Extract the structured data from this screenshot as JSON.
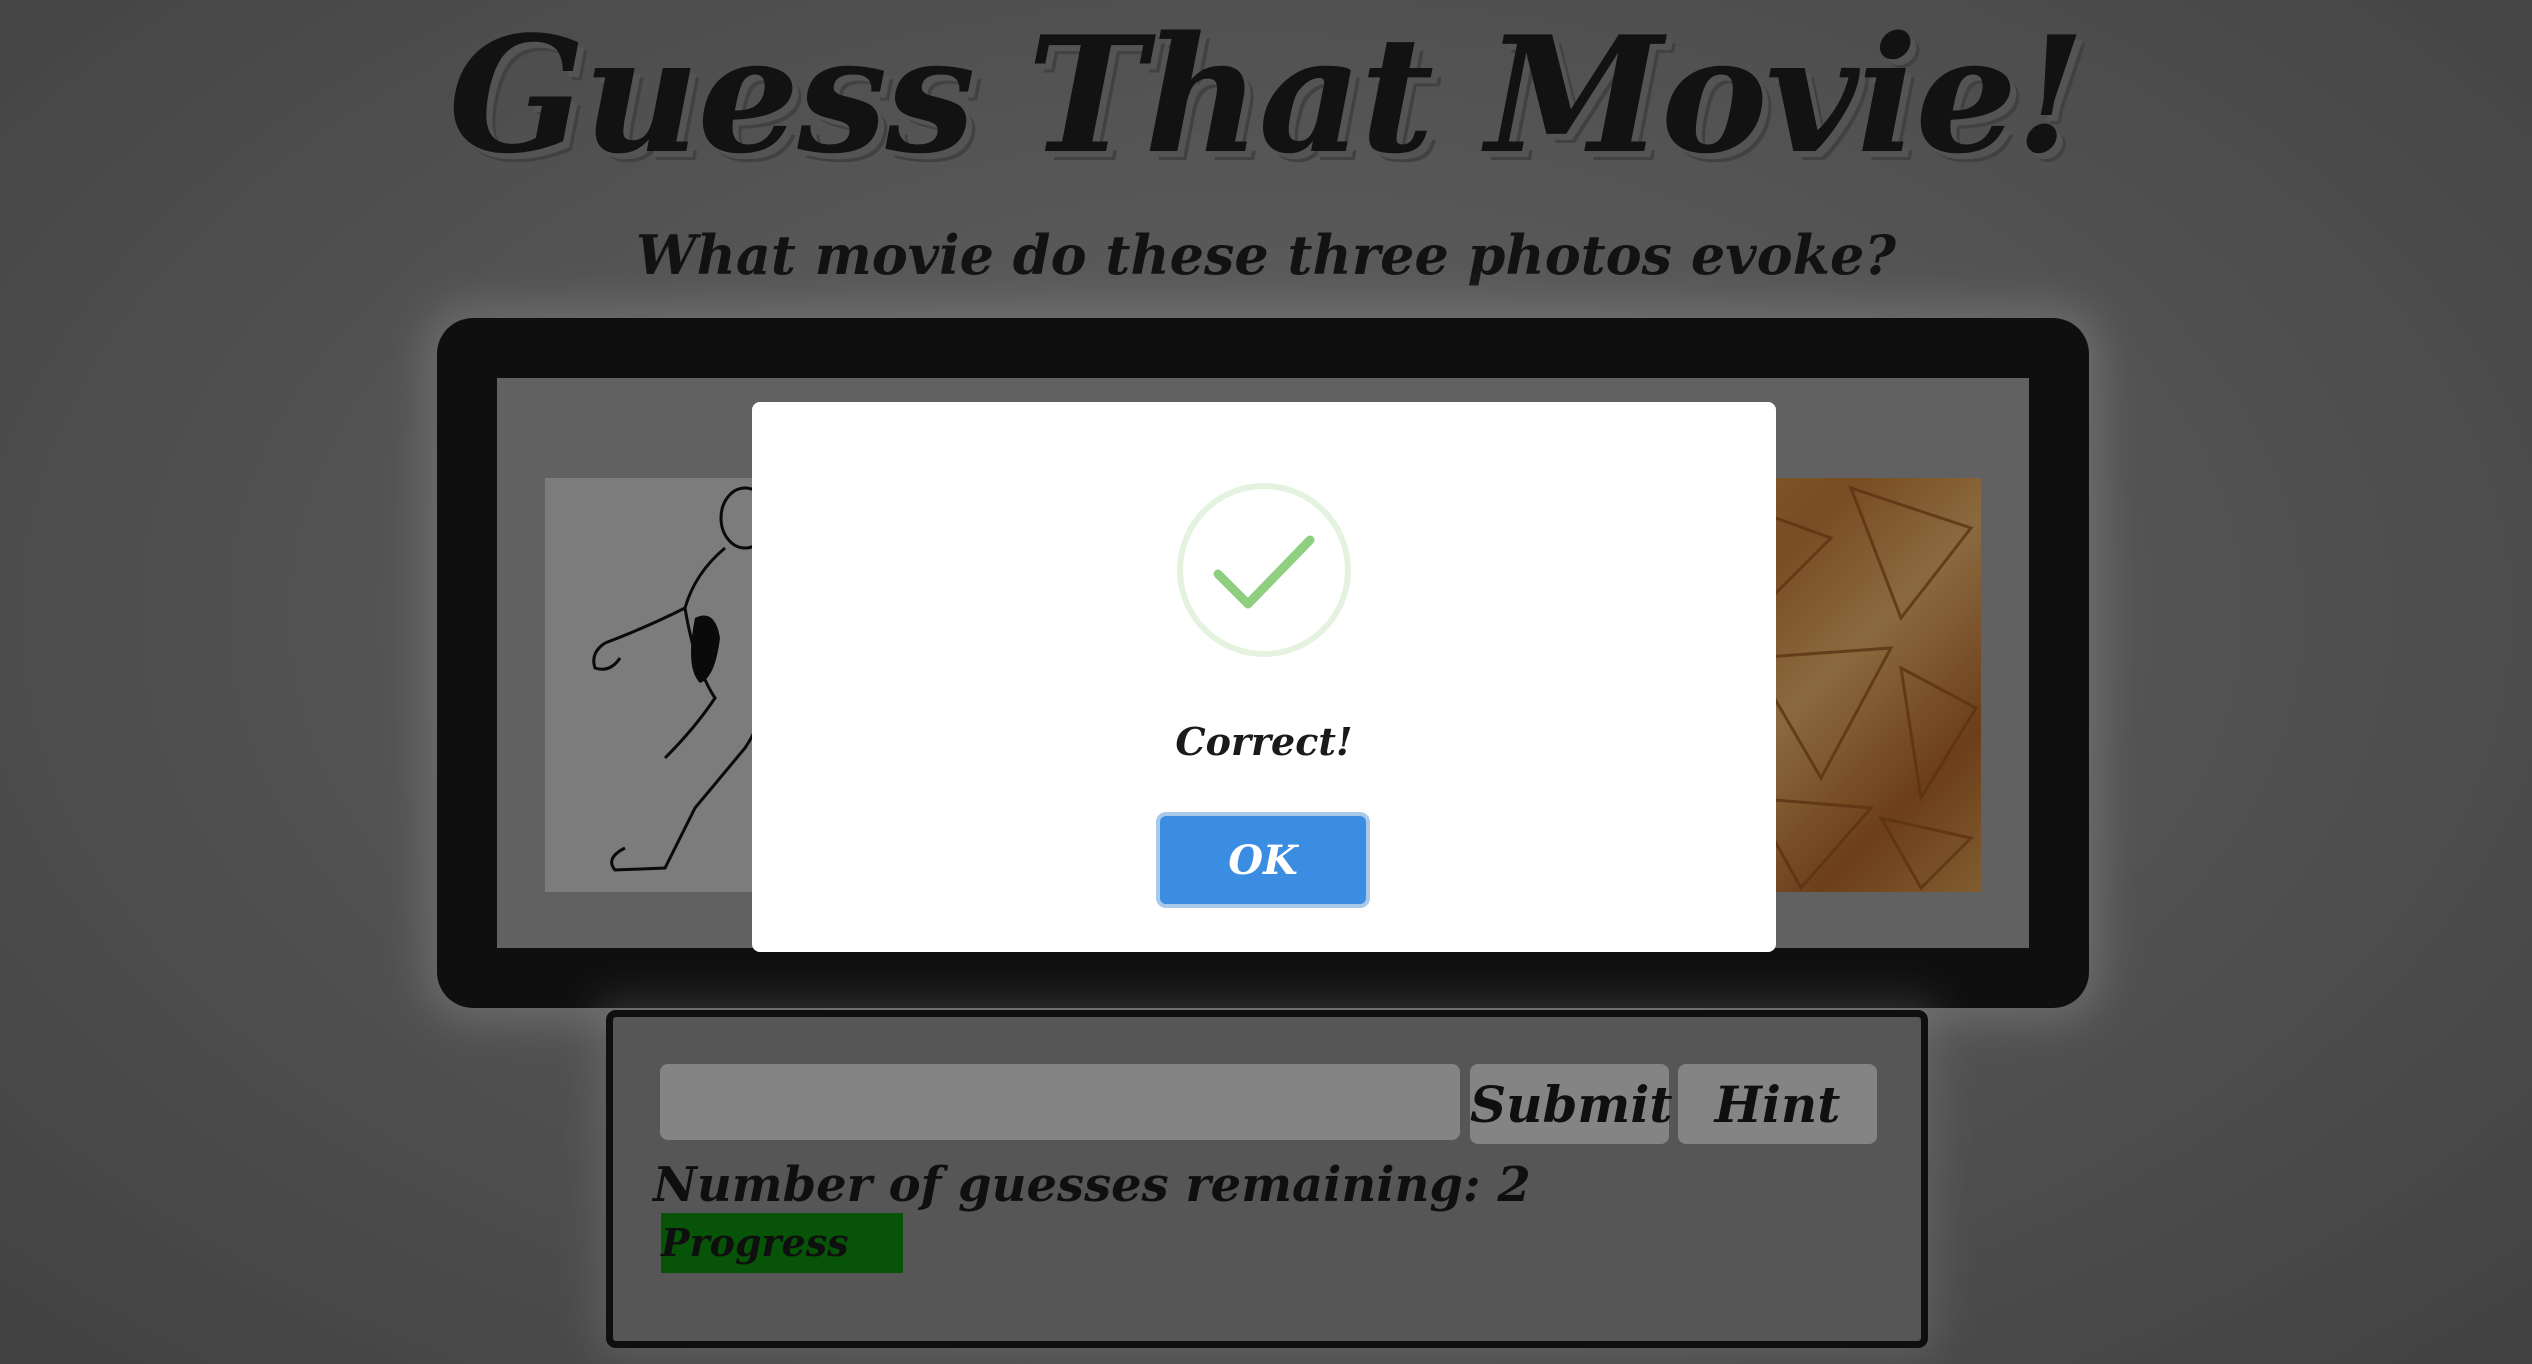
{
  "header": {
    "title": "Guess That Movie!",
    "subtitle": "What movie do these three photos evoke?"
  },
  "photos": [
    {
      "icon": "wrestler-illustration"
    },
    {
      "icon": "tortilla-chips-photo"
    }
  ],
  "guess_panel": {
    "input_value": "",
    "input_placeholder": "",
    "submit_label": "Submit",
    "hint_label": "Hint",
    "remaining_label": "Number of guesses remaining:",
    "remaining_value": "2",
    "progress_label": "Progress",
    "progress_color": "#0d8a0d"
  },
  "modal": {
    "icon": "success-check-icon",
    "message": "Correct!",
    "ok_label": "OK",
    "accent_color": "#3a8de0",
    "check_color": "#8fd080"
  }
}
